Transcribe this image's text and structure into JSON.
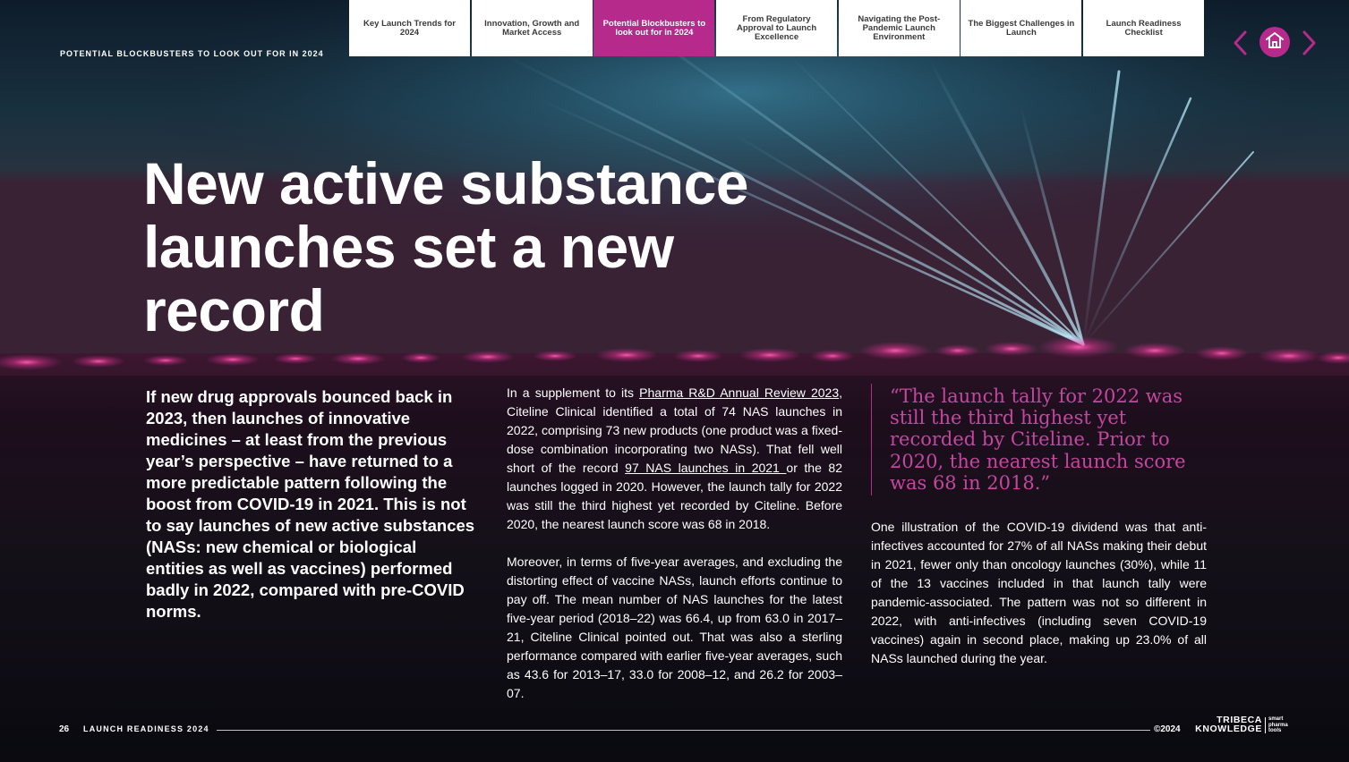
{
  "header": {
    "section_label": "POTENTIAL BLOCKBUSTERS TO LOOK OUT FOR IN 2024"
  },
  "nav": {
    "tabs": [
      {
        "label": "Key Launch Trends for 2024",
        "active": false
      },
      {
        "label": "Innovation, Growth and Market Access",
        "active": false
      },
      {
        "label": "Potential Blockbusters to look out for in 2024",
        "active": true
      },
      {
        "label": "From Regulatory Approval to Launch Excellence",
        "active": false
      },
      {
        "label": "Navigating the Post-Pandemic Launch Environment",
        "active": false
      },
      {
        "label": "The Biggest Challenges in Launch",
        "active": false
      },
      {
        "label": "Launch Readiness Checklist",
        "active": false
      }
    ],
    "prev_icon": "chevron-left-icon",
    "home_icon": "home-icon",
    "next_icon": "chevron-right-icon"
  },
  "article": {
    "title": "New active substance launches set a new record",
    "intro": "If new drug approvals bounced back in 2023, then launches of innovative medicines – at least from the previous year’s perspective – have returned to a more predictable pattern following the boost from COVID-19 in 2021. This is not to say launches of new active substances (NASs: new chemical or biological entities as well as vaccines) performed badly in 2022, compared with pre-COVID norms.",
    "col2_p1_a": "In a supplement to its ",
    "col2_p1_link1": "Pharma R&D Annual Review 2023",
    "col2_p1_b": ", Citeline Clinical identified a total of 74 NAS launches in 2022, comprising 73 new products (one product was a fixed-dose combination incorporating two NASs). That fell well short of the record ",
    "col2_p1_link2": "97 NAS launches in 2021 ",
    "col2_p1_c": "or the 82 launches logged in 2020. However, the launch tally for 2022 was still the third highest yet recorded by Citeline. Before 2020, the nearest launch score was 68 in 2018.",
    "col2_p2": "Moreover, in terms of five-year averages, and excluding the distorting effect of vaccine NASs, launch efforts continue to pay off. The mean number of NAS launches for the latest five-year period (2018–22) was 66.4, up from 63.0 in 2017–21, Citeline Clinical pointed out. That was also a sterling performance compared with earlier five-year averages, such as 43.6 for 2013–17, 33.0 for 2008–12, and 26.2 for 2003–07.",
    "pull_quote": "“The launch tally for 2022 was still the third highest yet recorded by Citeline. Prior to 2020, the nearest launch score was 68 in 2018.”",
    "col3_p1": "One illustration of the COVID-19 dividend was that anti-infectives accounted for 27% of all NASs making their debut in 2021, fewer only than oncology launches (30%), while 11 of the 13 vaccines included in that launch tally were pandemic-associated. The pattern was not so different in 2022, with anti-infectives (including seven COVID-19 vaccines) again in second place, making up 23.0% of all NASs launched during the year."
  },
  "footer": {
    "page_number": "26",
    "publication": "LAUNCH READINESS 2024",
    "copyright": "©2024",
    "logo_line1": "TRIBECA",
    "logo_line2": "KNOWLEDGE",
    "logo_tag1": "smart",
    "logo_tag2": "pharma",
    "logo_tag3": "tools"
  },
  "colors": {
    "accent": "#b62a8c",
    "quote": "#c3479f",
    "nav_bg": "#ffffff"
  }
}
